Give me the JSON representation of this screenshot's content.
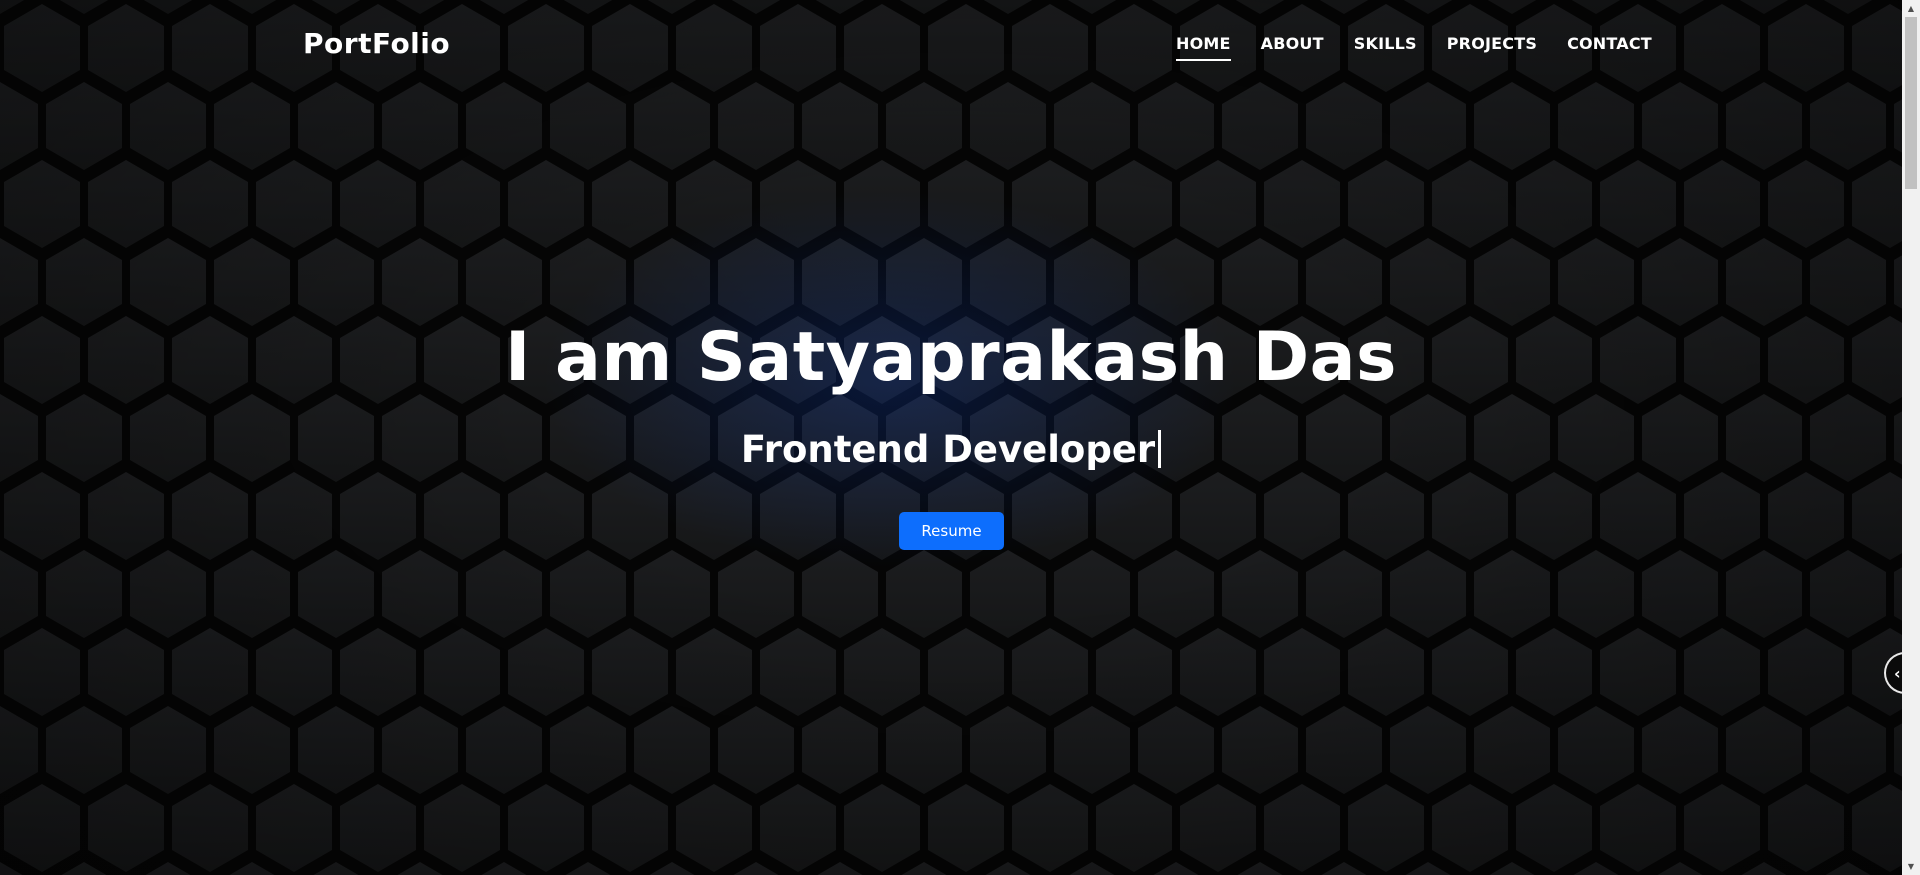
{
  "navbar": {
    "brand": "PortFolio",
    "links": [
      {
        "label": "HOME",
        "active": true
      },
      {
        "label": "ABOUT",
        "active": false
      },
      {
        "label": "SKILLS",
        "active": false
      },
      {
        "label": "PROJECTS",
        "active": false
      },
      {
        "label": "CONTACT",
        "active": false
      }
    ]
  },
  "hero": {
    "title": "I am Satyaprakash Das",
    "subtitle": "Frontend Developer",
    "button_label": "Resume"
  },
  "side_tab": {
    "icon": "chevron-left-icon"
  },
  "colors": {
    "background": "#141516",
    "accent": "#0d6efd",
    "glow": "#1446be",
    "text": "#ffffff"
  }
}
